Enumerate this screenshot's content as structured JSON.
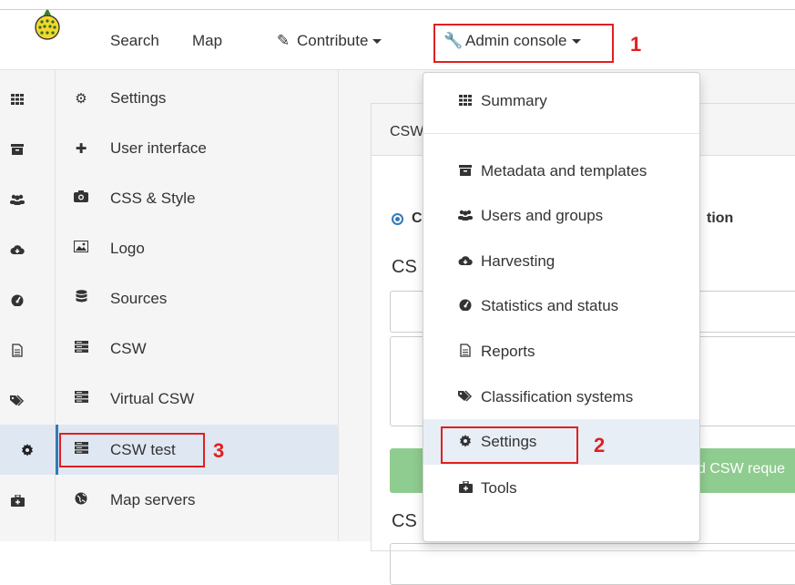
{
  "navbar": {
    "search": "Search",
    "map": "Map",
    "contribute": "Contribute",
    "admin_console": "Admin console"
  },
  "annotations": {
    "n1": "1",
    "n2": "2",
    "n3": "3"
  },
  "sidebar": {
    "items": [
      {
        "label": "Settings",
        "icon": "cogs-icon"
      },
      {
        "label": "User interface",
        "icon": "puzzle-icon"
      },
      {
        "label": "CSS & Style",
        "icon": "camera-icon"
      },
      {
        "label": "Logo",
        "icon": "image-icon"
      },
      {
        "label": "Sources",
        "icon": "database-icon"
      },
      {
        "label": "CSW",
        "icon": "server-icon"
      },
      {
        "label": "Virtual CSW",
        "icon": "server-icon"
      },
      {
        "label": "CSW test",
        "icon": "server-icon"
      },
      {
        "label": "Map servers",
        "icon": "globe-icon"
      }
    ]
  },
  "iconbar": [
    "th-icon",
    "archive-icon",
    "users-icon",
    "cloud-icon",
    "dashboard-icon",
    "file-icon",
    "tags-icon",
    "cog-icon",
    "medkit-icon"
  ],
  "dropdown": {
    "items": [
      {
        "label": "Summary",
        "icon": "th-icon"
      },
      {
        "label": "Metadata and templates",
        "icon": "archive-icon"
      },
      {
        "label": "Users and groups",
        "icon": "users-icon"
      },
      {
        "label": "Harvesting",
        "icon": "cloud-icon"
      },
      {
        "label": "Statistics and status",
        "icon": "dashboard-icon"
      },
      {
        "label": "Reports",
        "icon": "file-icon"
      },
      {
        "label": "Classification systems",
        "icon": "tags-icon"
      },
      {
        "label": "Settings",
        "icon": "cog-icon"
      },
      {
        "label": "Tools",
        "icon": "medkit-icon"
      }
    ]
  },
  "main": {
    "panel_title": "CSW",
    "radio_label": "C",
    "radio_label_end": "tion",
    "section1": "CS",
    "button_text": "d CSW reque",
    "section2": "CS"
  },
  "colors": {
    "accent": "#337ab7",
    "highlight": "#e02020",
    "button": "#8fcc8f"
  }
}
